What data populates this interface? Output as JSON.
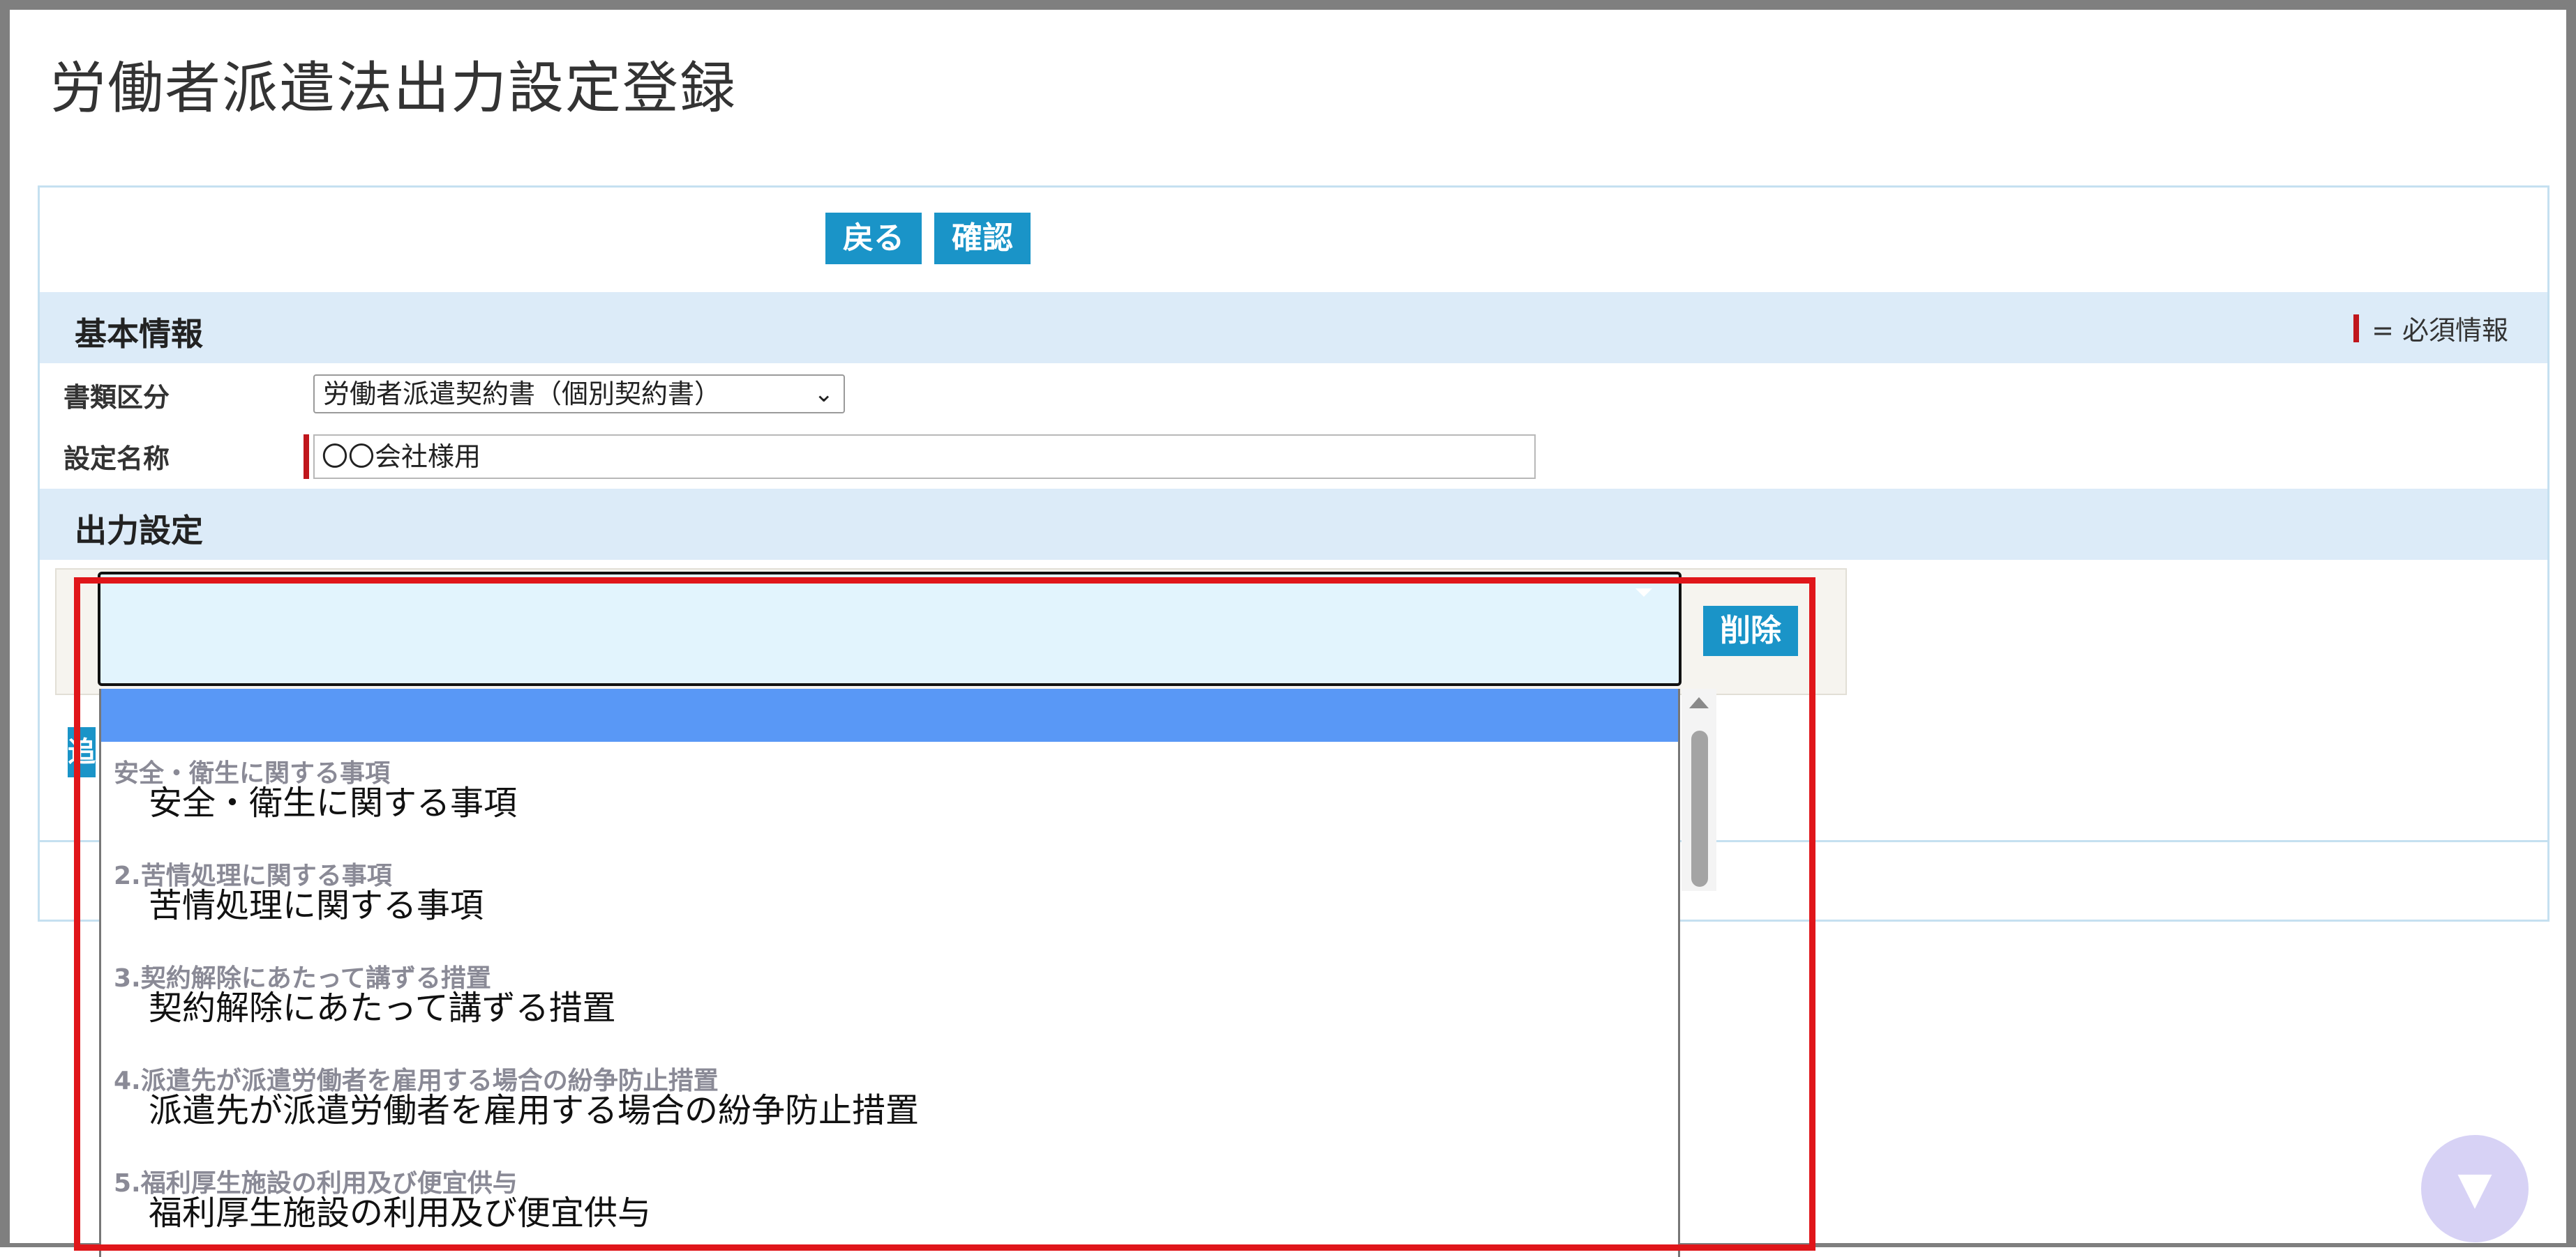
{
  "page": {
    "title": "労働者派遣法出力設定登録"
  },
  "toolbar": {
    "back_label": "戻る",
    "confirm_label": "確認"
  },
  "basic_section": {
    "title": "基本情報",
    "required_legend": "= 必須情報",
    "doc_type_label": "書類区分",
    "doc_type_value": "労働者派遣契約書（個別契約書）",
    "setting_name_label": "設定名称",
    "setting_name_value": "〇〇会社様用"
  },
  "output_section": {
    "title": "出力設定",
    "delete_label": "削除",
    "add_label_peek": "追"
  },
  "dropdown": {
    "options": [
      {
        "group": "安全・衛生に関する事項",
        "label": "安全・衛生に関する事項"
      },
      {
        "group": "2.苦情処理に関する事項",
        "label": "苦情処理に関する事項"
      },
      {
        "group": "3.契約解除にあたって講ずる措置",
        "label": "契約解除にあたって講ずる措置"
      },
      {
        "group": "4.派遣先が派遣労働者を雇用する場合の紛争防止措置",
        "label": "派遣先が派遣労働者を雇用する場合の紛争防止措置"
      },
      {
        "group": "5.福利厚生施設の利用及び便宜供与",
        "label": "福利厚生施設の利用及び便宜供与"
      }
    ]
  },
  "colors": {
    "accent": "#1a94c8",
    "required": "#c0161c",
    "section_bg": "#dcebf8",
    "highlight": "#e0161a"
  }
}
